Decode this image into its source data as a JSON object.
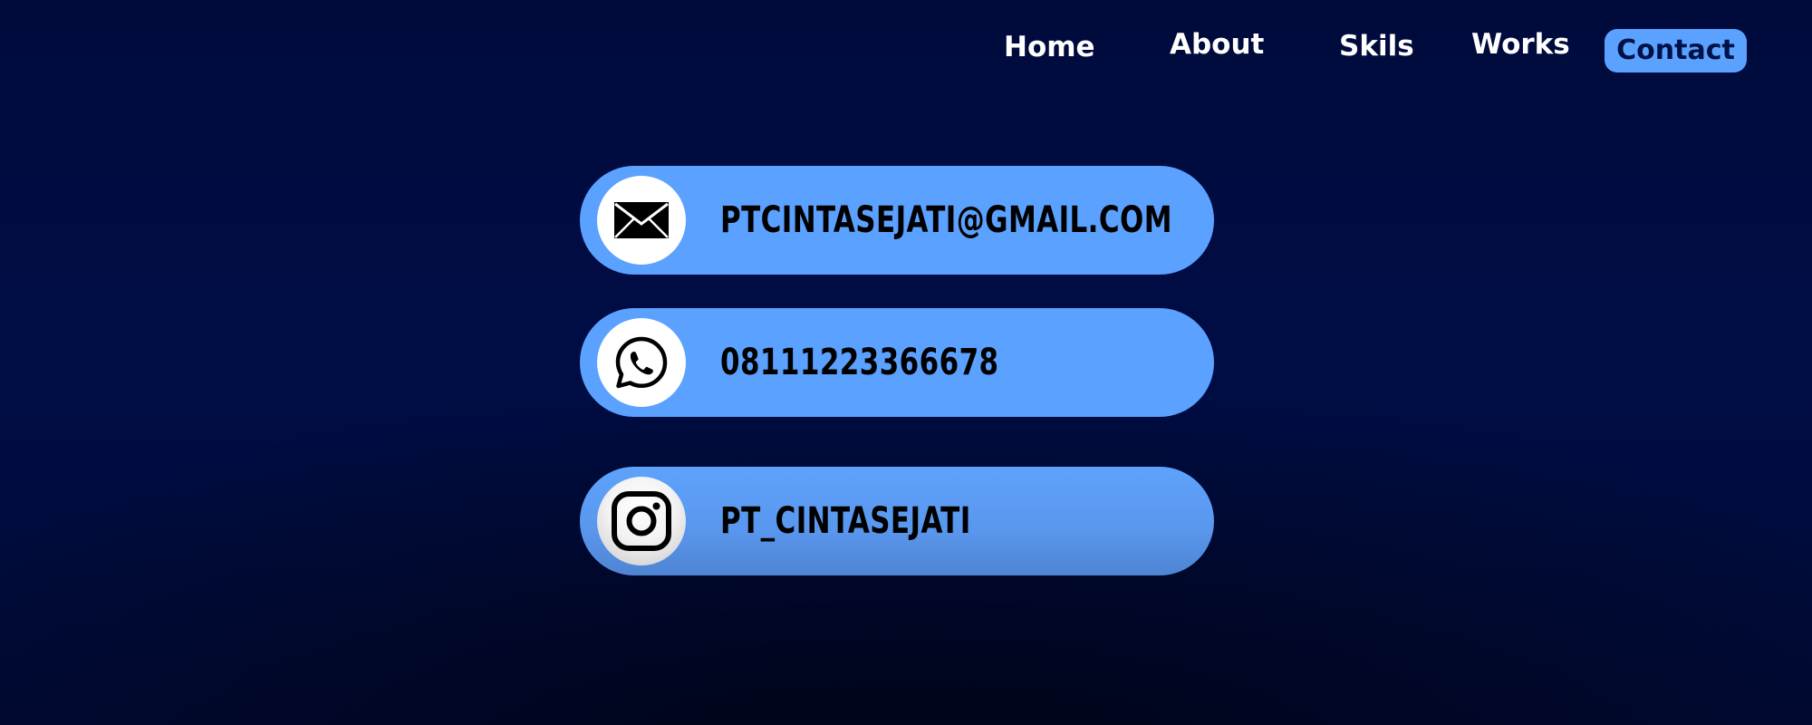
{
  "nav": {
    "items": [
      {
        "label": "Home"
      },
      {
        "label": "About"
      },
      {
        "label": "Skils"
      },
      {
        "label": "Works"
      },
      {
        "label": "Contact",
        "active": true
      }
    ]
  },
  "contacts": [
    {
      "type": "email",
      "icon": "envelope-icon",
      "text": "PTCINTASEJATI@GMAIL.COM"
    },
    {
      "type": "whatsapp",
      "icon": "whatsapp-icon",
      "text": "08111223366678"
    },
    {
      "type": "instagram",
      "icon": "instagram-icon",
      "text": "PT_CINTASEJATI"
    }
  ],
  "colors": {
    "background": "#000d45",
    "accent": "#5ba1ff",
    "nav_active_text": "#001148",
    "nav_text": "#ffffff",
    "contact_text": "#000000"
  }
}
